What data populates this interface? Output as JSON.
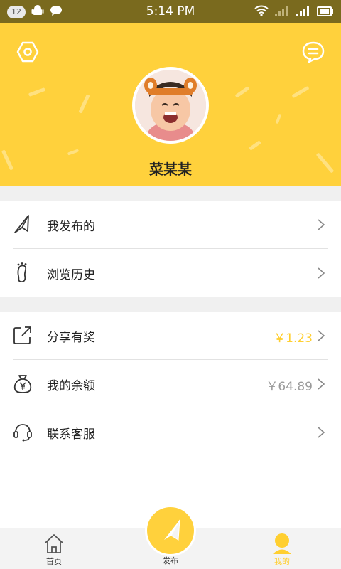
{
  "status_bar": {
    "notification_count": "12",
    "time": "5:14 PM",
    "icons": [
      "android-icon",
      "chat-bubble-icon",
      "wifi-icon",
      "signal-icon",
      "signal-icon",
      "battery-icon"
    ]
  },
  "header": {
    "settings_icon": "hexagon-settings-icon",
    "message_icon": "message-icon",
    "avatar": "user-avatar",
    "username": "菜某某"
  },
  "menu_group1": [
    {
      "icon": "send-arrow-icon",
      "label": "我发布的",
      "value": ""
    },
    {
      "icon": "footprint-icon",
      "label": "浏览历史",
      "value": ""
    }
  ],
  "menu_group2": [
    {
      "icon": "share-icon",
      "label": "分享有奖",
      "value": "￥1.23",
      "value_color": "#ffcf30"
    },
    {
      "icon": "money-bag-icon",
      "label": "我的余额",
      "value": "￥64.89",
      "value_color": "#9a9a9a"
    },
    {
      "icon": "headset-icon",
      "label": "联系客服",
      "value": ""
    }
  ],
  "tab_bar": {
    "home_label": "首页",
    "publish_label": "发布",
    "mine_label": "我的",
    "active_tab": "mine"
  },
  "colors": {
    "accent": "#ffd13c",
    "accent_text": "#ffcf30",
    "gray_text": "#9a9a9a"
  }
}
